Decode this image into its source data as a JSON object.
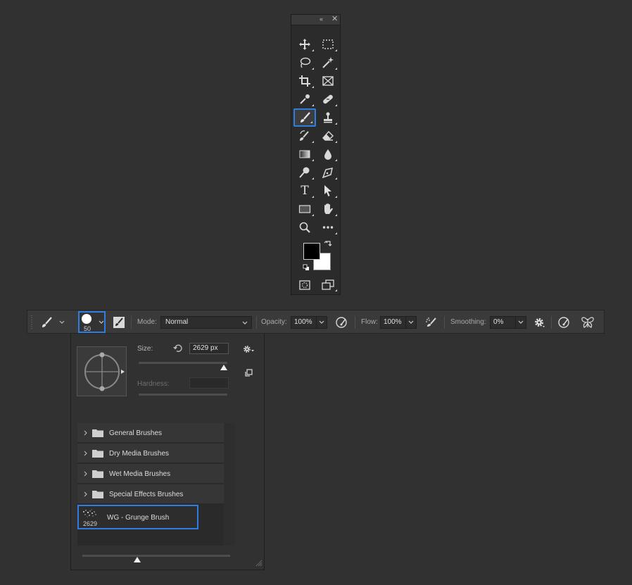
{
  "tools_panel": {
    "collapse_glyph": "«",
    "close_glyph": "✕",
    "tools": [
      {
        "name": "move-tool",
        "icon": "move-icon"
      },
      {
        "name": "rectangular-marquee-tool",
        "icon": "marquee-icon"
      },
      {
        "name": "lasso-tool",
        "icon": "lasso-icon"
      },
      {
        "name": "magic-wand-tool",
        "icon": "magic-wand-icon"
      },
      {
        "name": "crop-tool",
        "icon": "crop-icon"
      },
      {
        "name": "frame-tool",
        "icon": "frame-icon"
      },
      {
        "name": "eyedropper-tool",
        "icon": "eyedropper-icon"
      },
      {
        "name": "healing-brush-tool",
        "icon": "bandage-icon"
      },
      {
        "name": "brush-tool",
        "icon": "brush-icon",
        "selected": true
      },
      {
        "name": "clone-stamp-tool",
        "icon": "stamp-icon"
      },
      {
        "name": "history-brush-tool",
        "icon": "history-brush-icon"
      },
      {
        "name": "eraser-tool",
        "icon": "eraser-icon"
      },
      {
        "name": "gradient-tool",
        "icon": "gradient-icon"
      },
      {
        "name": "blur-tool",
        "icon": "drop-icon"
      },
      {
        "name": "dodge-tool",
        "icon": "dodge-icon"
      },
      {
        "name": "pen-tool",
        "icon": "pen-icon"
      },
      {
        "name": "type-tool",
        "icon": "type-icon",
        "glyph": "T"
      },
      {
        "name": "path-selection-tool",
        "icon": "arrow-icon"
      },
      {
        "name": "rectangle-tool",
        "icon": "rectangle-icon"
      },
      {
        "name": "hand-tool",
        "icon": "hand-icon"
      },
      {
        "name": "zoom-tool",
        "icon": "zoom-icon"
      },
      {
        "name": "edit-toolbar",
        "icon": "more-icon"
      }
    ],
    "foreground_color": "#000000",
    "background_color": "#ffffff"
  },
  "options_bar": {
    "brush_size": "50",
    "mode_label": "Mode:",
    "mode_value": "Normal",
    "opacity_label": "Opacity:",
    "opacity_value": "100%",
    "flow_label": "Flow:",
    "flow_value": "100%",
    "smoothing_label": "Smoothing:",
    "smoothing_value": "0%"
  },
  "brush_picker": {
    "size_label": "Size:",
    "size_value": "2629 px",
    "size_slider": 1.0,
    "hardness_label": "Hardness:",
    "folders": [
      {
        "label": "General Brushes"
      },
      {
        "label": "Dry Media Brushes"
      },
      {
        "label": "Wet Media Brushes"
      },
      {
        "label": "Special Effects Brushes"
      }
    ],
    "selected_brush": {
      "name": "WG - Grunge Brush",
      "size": "2629"
    },
    "preview_zoom": 0.37
  },
  "colors": {
    "accent": "#2e7de1",
    "panel": "#2b2b2b",
    "background": "#313131"
  }
}
